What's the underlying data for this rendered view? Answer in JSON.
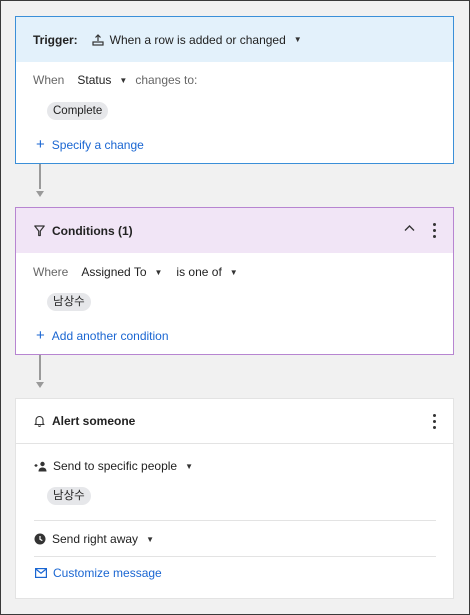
{
  "trigger": {
    "label": "Trigger:",
    "event": "When a row is added or changed",
    "when_label": "When",
    "column": "Status",
    "changes_to_label": "changes to:",
    "value_chip": "Complete",
    "specify_link": "Specify a change"
  },
  "conditions": {
    "title": "Conditions (1)",
    "where_label": "Where",
    "field": "Assigned To",
    "operator": "is one of",
    "value_chip": "남상수",
    "add_link": "Add another condition"
  },
  "action": {
    "title": "Alert someone",
    "recipients_label": "Send to specific people",
    "recipient_chip": "남상수",
    "timing_label": "Send right away",
    "customize_link": "Customize message"
  },
  "colors": {
    "trigger_accent": "#3b8fd8",
    "trigger_header_bg": "#e3f1fb",
    "conditions_accent": "#b785d1",
    "conditions_header_bg": "#f1e5f6",
    "link": "#1a66d2"
  }
}
